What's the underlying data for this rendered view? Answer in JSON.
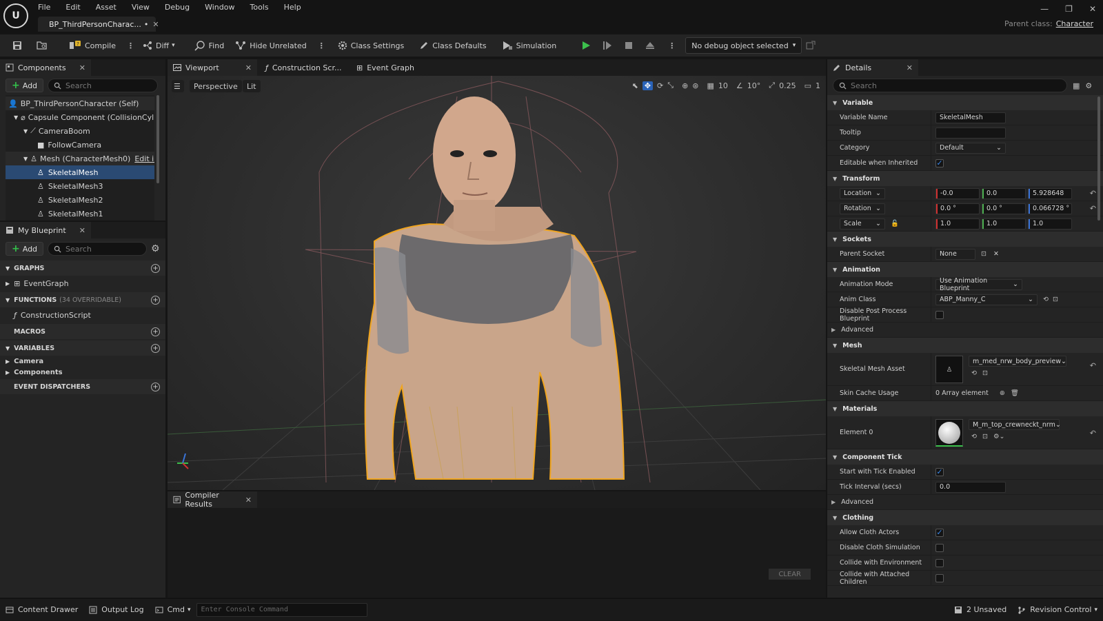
{
  "app": {
    "menu": [
      "File",
      "Edit",
      "Asset",
      "View",
      "Debug",
      "Window",
      "Tools",
      "Help"
    ],
    "doc_tab": "BP_ThirdPersonCharac...",
    "doc_tab_mod": "•",
    "parent_class_label": "Parent class:",
    "parent_class_value": "Character"
  },
  "toolbar": {
    "compile": "Compile",
    "diff": "Diff",
    "find": "Find",
    "hide_unrelated": "Hide Unrelated",
    "class_settings": "Class Settings",
    "class_defaults": "Class Defaults",
    "simulation": "Simulation",
    "debug_object": "No debug object selected"
  },
  "components": {
    "tab": "Components",
    "add": "Add",
    "search_placeholder": "Search",
    "items": [
      {
        "label": "BP_ThirdPersonCharacter (Self)"
      },
      {
        "label": "Capsule Component (CollisionCylinder)"
      },
      {
        "label": "CameraBoom"
      },
      {
        "label": "FollowCamera"
      },
      {
        "label": "Mesh (CharacterMesh0)",
        "extra": "Edit in C++"
      },
      {
        "label": "SkeletalMesh"
      },
      {
        "label": "SkeletalMesh3"
      },
      {
        "label": "SkeletalMesh2"
      },
      {
        "label": "SkeletalMesh1"
      }
    ]
  },
  "myblueprint": {
    "tab": "My Blueprint",
    "add": "Add",
    "search_placeholder": "Search",
    "graphs": "GRAPHS",
    "eventgraph": "EventGraph",
    "functions": "FUNCTIONS",
    "functions_count": "(34 OVERRIDABLE)",
    "constructionscript": "ConstructionScript",
    "macros": "MACROS",
    "variables": "VARIABLES",
    "camera": "Camera",
    "components": "Components",
    "dispatchers": "EVENT DISPATCHERS"
  },
  "viewport": {
    "tabs": [
      "Viewport",
      "Construction Scr...",
      "Event Graph"
    ],
    "perspective": "Perspective",
    "lit": "Lit",
    "grid": "10",
    "angle": "10°",
    "scale": "0.25",
    "cam": "1"
  },
  "compiler": {
    "tab": "Compiler Results",
    "clear": "CLEAR"
  },
  "details": {
    "tab": "Details",
    "search_placeholder": "Search",
    "variable": {
      "section": "Variable",
      "name_label": "Variable Name",
      "name_value": "SkeletalMesh",
      "tooltip_label": "Tooltip",
      "tooltip_value": "",
      "category_label": "Category",
      "category_value": "Default",
      "editable_label": "Editable when Inherited"
    },
    "transform": {
      "section": "Transform",
      "location": "Location",
      "loc": [
        "-0.0",
        "0.0",
        "5.928648"
      ],
      "rotation": "Rotation",
      "rot": [
        "0.0 °",
        "0.0 °",
        "0.066728 °"
      ],
      "scale": "Scale",
      "scl": [
        "1.0",
        "1.0",
        "1.0"
      ]
    },
    "sockets": {
      "section": "Sockets",
      "parent_label": "Parent Socket",
      "parent_value": "None"
    },
    "animation": {
      "section": "Animation",
      "mode_label": "Animation Mode",
      "mode_value": "Use Animation Blueprint",
      "class_label": "Anim Class",
      "class_value": "ABP_Manny_C",
      "disable_label": "Disable Post Process Blueprint",
      "advanced": "Advanced"
    },
    "mesh": {
      "section": "Mesh",
      "asset_label": "Skeletal Mesh Asset",
      "asset_value": "m_med_nrw_body_preview",
      "skin_label": "Skin Cache Usage",
      "skin_value": "0 Array element"
    },
    "materials": {
      "section": "Materials",
      "element_label": "Element 0",
      "element_value": "M_m_top_crewneckt_nrm"
    },
    "tick": {
      "section": "Component Tick",
      "start_label": "Start with Tick Enabled",
      "interval_label": "Tick Interval (secs)",
      "interval_value": "0.0",
      "advanced": "Advanced"
    },
    "clothing": {
      "section": "Clothing",
      "allow": "Allow Cloth Actors",
      "disable": "Disable Cloth Simulation",
      "collide_env": "Collide with Environment",
      "collide_children": "Collide with Attached Children"
    }
  },
  "statusbar": {
    "content_drawer": "Content Drawer",
    "output_log": "Output Log",
    "cmd": "Cmd",
    "console_placeholder": "Enter Console Command",
    "unsaved": "2 Unsaved",
    "revision": "Revision Control"
  }
}
